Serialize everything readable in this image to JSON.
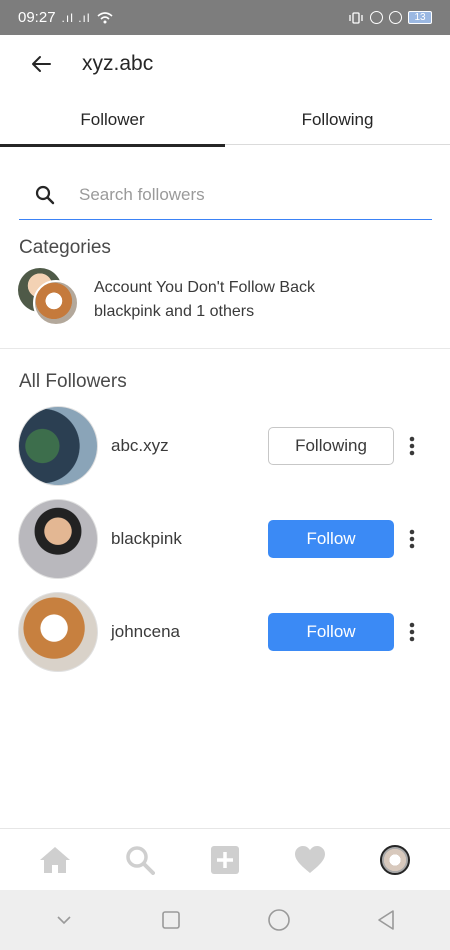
{
  "status_bar": {
    "time": "09:27",
    "signal": ".ıl .ıl",
    "battery": "13"
  },
  "header": {
    "title": "xyz.abc"
  },
  "tabs": [
    {
      "label": "Follower",
      "active": true
    },
    {
      "label": "Following",
      "active": false
    }
  ],
  "search": {
    "placeholder": "Search followers",
    "value": ""
  },
  "categories": {
    "title": "Categories",
    "item": {
      "title": "Account You Don't Follow Back",
      "subtitle": "blackpink and 1 others"
    }
  },
  "followers": {
    "title": "All Followers",
    "items": [
      {
        "username": "abc.xyz",
        "button": "Following"
      },
      {
        "username": "blackpink",
        "button": "Follow"
      },
      {
        "username": "johncena",
        "button": "Follow"
      }
    ]
  },
  "bottom_nav": [
    "home-icon",
    "search-icon",
    "add-icon",
    "heart-icon",
    "profile-avatar"
  ],
  "colors": {
    "accent": "#3b8af5",
    "status_bar": "#7d7d7d",
    "icon_inactive": "#cfcfcf"
  }
}
